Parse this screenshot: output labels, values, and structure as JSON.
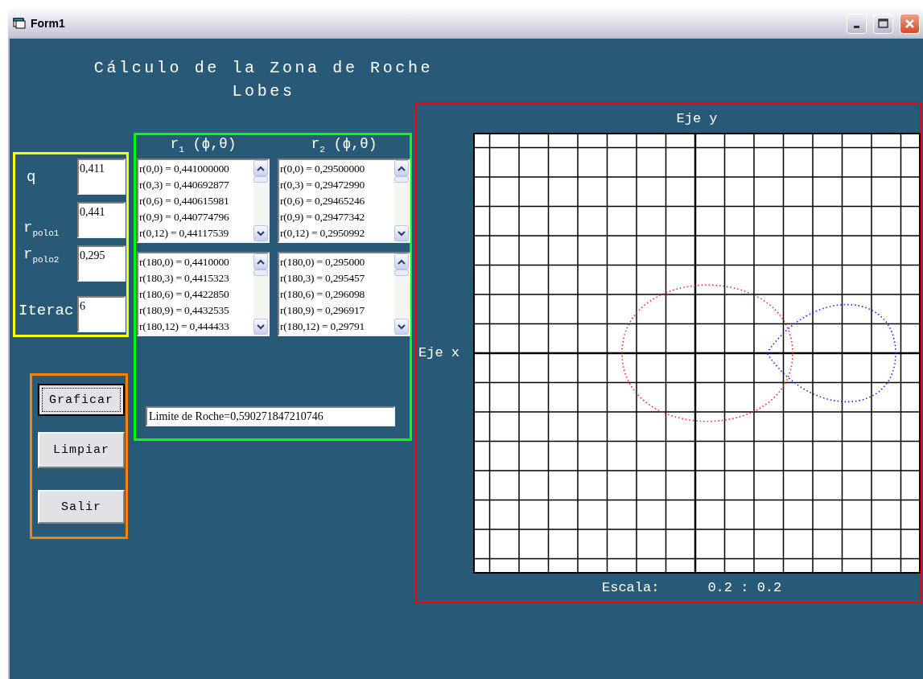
{
  "window": {
    "title": "Form1"
  },
  "heading": [
    "Cálculo de la Zona de Roche",
    "Lobes"
  ],
  "inputs": [
    {
      "label": "q",
      "value": "0,411"
    },
    {
      "label": "r$_{polo1}$",
      "value": "0,441"
    },
    {
      "label": "r$_{polo2}$",
      "value": "0,295"
    },
    {
      "label": "Iterac",
      "value": "6"
    }
  ],
  "list_headers": [
    "r$_{1}$ (ϕ,θ)",
    "r$_{2}$ (ϕ,θ)"
  ],
  "lists": [
    {
      "items": [
        "r(0,0) = 0,441000000",
        "r(0,3) = 0,440692877",
        "r(0,6) = 0,440615981",
        "r(0,9) = 0,440774796",
        "r(0,12) = 0,44117539"
      ]
    },
    {
      "items": [
        "r(0,0) = 0,29500000",
        "r(0,3) = 0,29472990",
        "r(0,6) = 0,29465246",
        "r(0,9) = 0,29477342",
        "r(0,12) = 0,2950992"
      ]
    },
    {
      "items": [
        "r(180,0) = 0,4410000",
        "r(180,3) = 0,4415323",
        "r(180,6) = 0,4422850",
        "r(180,9) = 0,4432535",
        "r(180,12) = 0,444433"
      ]
    },
    {
      "items": [
        "r(180,0) = 0,295000",
        "r(180,3) = 0,295457",
        "r(180,6) = 0,296098",
        "r(180,9) = 0,296917",
        "r(180,12) = 0,29791"
      ]
    }
  ],
  "roche_field": {
    "value": "Limite de Roche=0,590271847210746"
  },
  "buttons": [
    {
      "label": "Graficar",
      "focused": true
    },
    {
      "label": "Limpiar",
      "focused": false
    },
    {
      "label": "Salir",
      "focused": false
    }
  ],
  "plot": {
    "y_axis_label": "Eje y",
    "x_axis_label": "Eje x",
    "scale_label": "Escala:",
    "scale_value": "0.2 : 0.2"
  }
}
